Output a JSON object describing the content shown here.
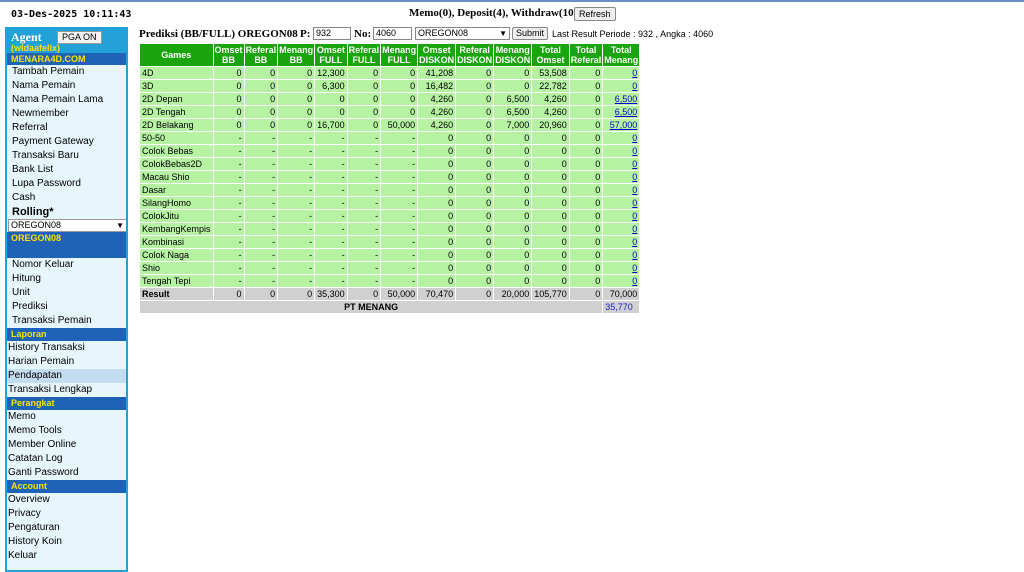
{
  "header": {
    "datetime": "03-Des-2025 10:11:43",
    "memo_status": "Memo(0), Deposit(4), Withdraw(10)",
    "refresh_label": "Refresh"
  },
  "sidebar": {
    "agent_title": "Agent",
    "pga_label": "PGA ON",
    "agent_user": "(wldaafelix)",
    "site": "MENARA4D.COM",
    "items_top": [
      "Tambah Pemain",
      "Nama Pemain",
      "Nama Pemain Lama",
      "Newmember",
      "Referral",
      "Payment Gateway",
      "Transaksi Baru",
      "Bank List",
      "Lupa Password",
      "Cash"
    ],
    "rolling_label": "Rolling*",
    "pasaran_selected": "OREGON08",
    "pasaran_title": "OREGON08",
    "items_pasaran": [
      "Nomor Keluar",
      "Hitung",
      "Unit",
      "Prediksi",
      "Transaksi Pemain"
    ],
    "laporan_title": "Laporan",
    "items_laporan": [
      "History Transaksi",
      "Harian Pemain",
      "Pendapatan",
      "Transaksi Lengkap"
    ],
    "perangkat_title": "Perangkat",
    "items_perangkat": [
      "Memo",
      "Memo Tools",
      "Member Online",
      "Catatan Log",
      "Ganti Password"
    ],
    "account_title": "Account",
    "items_account": [
      "Overview",
      "Privacy",
      "Pengaturan",
      "History Koin",
      "Keluar"
    ]
  },
  "prediksi": {
    "title": "Prediksi (BB/FULL) OREGON08",
    "p_label": "P:",
    "p_value": "932",
    "no_label": "No:",
    "no_value": "4060",
    "market_selected": "OREGON08",
    "submit_label": "Submit",
    "last_result": "Last Result Periode : 932 , Angka : 4060"
  },
  "table": {
    "headers": [
      [
        "Games"
      ],
      [
        "Omset",
        "BB"
      ],
      [
        "Referal",
        "BB"
      ],
      [
        "Menang",
        "BB"
      ],
      [
        "Omset",
        "FULL"
      ],
      [
        "Referal",
        "FULL"
      ],
      [
        "Menang",
        "FULL"
      ],
      [
        "Omset",
        "DISKON"
      ],
      [
        "Referal",
        "DISKON"
      ],
      [
        "Menang",
        "DISKON"
      ],
      [
        "Total",
        "Omset"
      ],
      [
        "Total",
        "Referal"
      ],
      [
        "Total",
        "Menang"
      ]
    ],
    "rows": [
      [
        "4D",
        "0",
        "0",
        "0",
        "12,300",
        "0",
        "0",
        "41,208",
        "0",
        "0",
        "53,508",
        "0",
        "0"
      ],
      [
        "3D",
        "0",
        "0",
        "0",
        "6,300",
        "0",
        "0",
        "16,482",
        "0",
        "0",
        "22,782",
        "0",
        "0"
      ],
      [
        "2D Depan",
        "0",
        "0",
        "0",
        "0",
        "0",
        "0",
        "4,260",
        "0",
        "6,500",
        "4,260",
        "0",
        "6,500"
      ],
      [
        "2D Tengah",
        "0",
        "0",
        "0",
        "0",
        "0",
        "0",
        "4,260",
        "0",
        "6,500",
        "4,260",
        "0",
        "6,500"
      ],
      [
        "2D Belakang",
        "0",
        "0",
        "0",
        "16,700",
        "0",
        "50,000",
        "4,260",
        "0",
        "7,000",
        "20,960",
        "0",
        "57,000"
      ],
      [
        "50-50",
        "-",
        "-",
        "-",
        "-",
        "-",
        "-",
        "0",
        "0",
        "0",
        "0",
        "0",
        "0"
      ],
      [
        "Colok Bebas",
        "-",
        "-",
        "-",
        "-",
        "-",
        "-",
        "0",
        "0",
        "0",
        "0",
        "0",
        "0"
      ],
      [
        "ColokBebas2D",
        "-",
        "-",
        "-",
        "-",
        "-",
        "-",
        "0",
        "0",
        "0",
        "0",
        "0",
        "0"
      ],
      [
        "Macau Shio",
        "-",
        "-",
        "-",
        "-",
        "-",
        "-",
        "0",
        "0",
        "0",
        "0",
        "0",
        "0"
      ],
      [
        "Dasar",
        "-",
        "-",
        "-",
        "-",
        "-",
        "-",
        "0",
        "0",
        "0",
        "0",
        "0",
        "0"
      ],
      [
        "SilangHomo",
        "-",
        "-",
        "-",
        "-",
        "-",
        "-",
        "0",
        "0",
        "0",
        "0",
        "0",
        "0"
      ],
      [
        "ColokJitu",
        "-",
        "-",
        "-",
        "-",
        "-",
        "-",
        "0",
        "0",
        "0",
        "0",
        "0",
        "0"
      ],
      [
        "KembangKempis",
        "-",
        "-",
        "-",
        "-",
        "-",
        "-",
        "0",
        "0",
        "0",
        "0",
        "0",
        "0"
      ],
      [
        "Kombinasi",
        "-",
        "-",
        "-",
        "-",
        "-",
        "-",
        "0",
        "0",
        "0",
        "0",
        "0",
        "0"
      ],
      [
        "Colok Naga",
        "-",
        "-",
        "-",
        "-",
        "-",
        "-",
        "0",
        "0",
        "0",
        "0",
        "0",
        "0"
      ],
      [
        "Shio",
        "-",
        "-",
        "-",
        "-",
        "-",
        "-",
        "0",
        "0",
        "0",
        "0",
        "0",
        "0"
      ],
      [
        "Tengah Tepi",
        "-",
        "-",
        "-",
        "-",
        "-",
        "-",
        "0",
        "0",
        "0",
        "0",
        "0",
        "0"
      ]
    ],
    "result_row": [
      "Result",
      "0",
      "0",
      "0",
      "35,300",
      "0",
      "50,000",
      "70,470",
      "0",
      "20,000",
      "105,770",
      "0",
      "70,000"
    ],
    "pt_menang_label": "PT MENANG",
    "pt_menang_value": "35,770"
  },
  "colors": {
    "header_green": "#1aa40e",
    "cell_green": "#b5f3a3",
    "sidebar_blue": "#1f63b7",
    "sidebar_light": "#e6f6fb",
    "accent_yellow": "#ffe000"
  }
}
